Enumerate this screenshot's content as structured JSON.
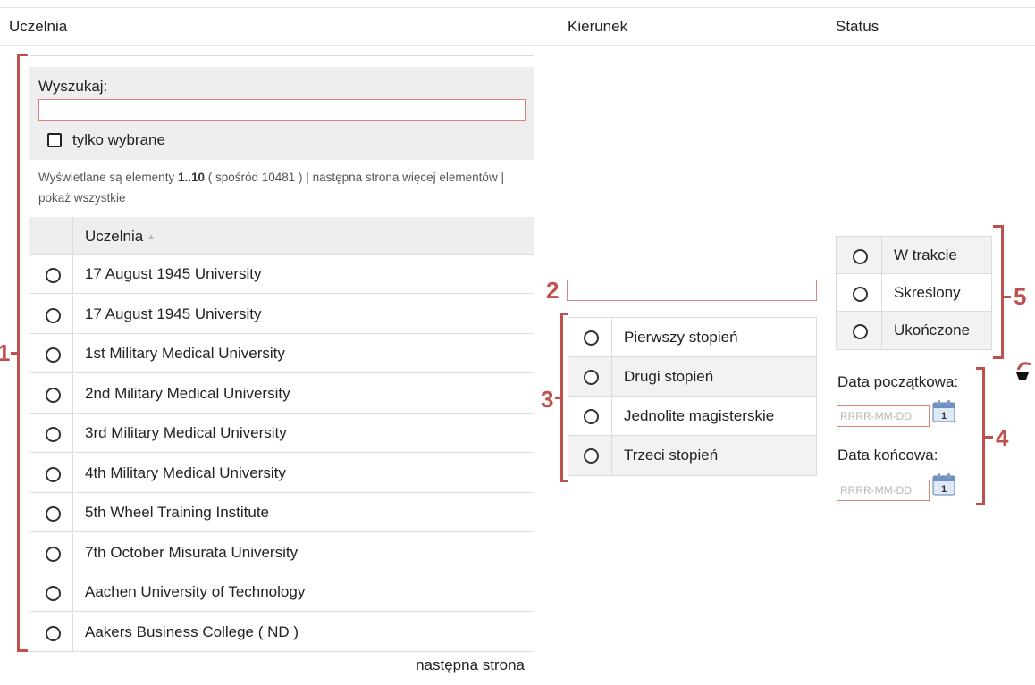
{
  "columns": {
    "uczelnia": "Uczelnia",
    "kierunek": "Kierunek",
    "status": "Status"
  },
  "uczelnia_panel": {
    "search_label": "Wyszukaj:",
    "search_value": "",
    "only_selected_label": "tylko wybrane",
    "info_prefix": "Wyświetlane są elementy ",
    "info_range": "1..10",
    "info_total": " ( spośród 10481 ) | ",
    "info_next": "następna strona",
    "info_more": " więcej elementów",
    "info_sep": " | ",
    "info_all": "pokaż wszystkie",
    "table_header": "Uczelnia",
    "sort_icon": "sort-ascending-icon",
    "rows": [
      "17 August 1945 University",
      "17 August 1945 University",
      "1st Military Medical University",
      "2nd Military Medical University",
      "3rd Military Medical University",
      "4th Military Medical University",
      "5th Wheel Training Institute",
      "7th October Misurata University",
      "Aachen University of Technology",
      "Aakers Business College ( ND )"
    ],
    "next_page": "następna strona"
  },
  "kierunek_panel": {
    "search_value": "",
    "degrees": [
      "Pierwszy stopień",
      "Drugi stopień",
      "Jednolite magisterskie",
      "Trzeci stopień"
    ]
  },
  "status_panel": {
    "options": [
      "W trakcie",
      "Skreślony",
      "Ukończone"
    ],
    "start_date_label": "Data początkowa:",
    "end_date_label": "Data końcowa:",
    "date_placeholder": "RRRR-MM-DD",
    "calendar_icon": "calendar-icon"
  },
  "annotations": {
    "labels": [
      "1",
      "2",
      "3",
      "4",
      "5"
    ],
    "color": "#c0504d"
  },
  "colors": {
    "accent": "#c0504d",
    "input_border": "#d9827e",
    "header_bg": "#eeeeee",
    "border": "#dcdcdc"
  }
}
